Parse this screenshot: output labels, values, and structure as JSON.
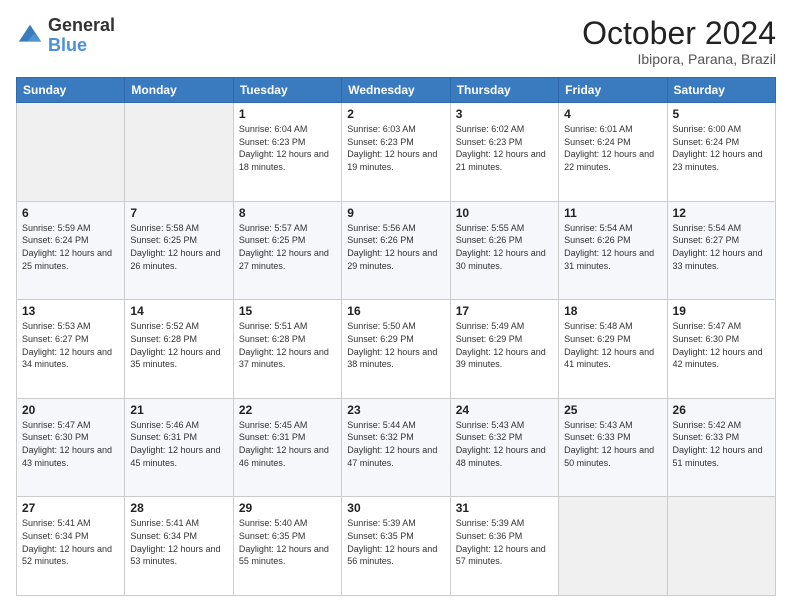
{
  "logo": {
    "general": "General",
    "blue": "Blue"
  },
  "title": {
    "month": "October 2024",
    "location": "Ibipora, Parana, Brazil"
  },
  "days_of_week": [
    "Sunday",
    "Monday",
    "Tuesday",
    "Wednesday",
    "Thursday",
    "Friday",
    "Saturday"
  ],
  "weeks": [
    [
      {
        "day": "",
        "info": ""
      },
      {
        "day": "",
        "info": ""
      },
      {
        "day": "1",
        "info": "Sunrise: 6:04 AM\nSunset: 6:23 PM\nDaylight: 12 hours and 18 minutes."
      },
      {
        "day": "2",
        "info": "Sunrise: 6:03 AM\nSunset: 6:23 PM\nDaylight: 12 hours and 19 minutes."
      },
      {
        "day": "3",
        "info": "Sunrise: 6:02 AM\nSunset: 6:23 PM\nDaylight: 12 hours and 21 minutes."
      },
      {
        "day": "4",
        "info": "Sunrise: 6:01 AM\nSunset: 6:24 PM\nDaylight: 12 hours and 22 minutes."
      },
      {
        "day": "5",
        "info": "Sunrise: 6:00 AM\nSunset: 6:24 PM\nDaylight: 12 hours and 23 minutes."
      }
    ],
    [
      {
        "day": "6",
        "info": "Sunrise: 5:59 AM\nSunset: 6:24 PM\nDaylight: 12 hours and 25 minutes."
      },
      {
        "day": "7",
        "info": "Sunrise: 5:58 AM\nSunset: 6:25 PM\nDaylight: 12 hours and 26 minutes."
      },
      {
        "day": "8",
        "info": "Sunrise: 5:57 AM\nSunset: 6:25 PM\nDaylight: 12 hours and 27 minutes."
      },
      {
        "day": "9",
        "info": "Sunrise: 5:56 AM\nSunset: 6:26 PM\nDaylight: 12 hours and 29 minutes."
      },
      {
        "day": "10",
        "info": "Sunrise: 5:55 AM\nSunset: 6:26 PM\nDaylight: 12 hours and 30 minutes."
      },
      {
        "day": "11",
        "info": "Sunrise: 5:54 AM\nSunset: 6:26 PM\nDaylight: 12 hours and 31 minutes."
      },
      {
        "day": "12",
        "info": "Sunrise: 5:54 AM\nSunset: 6:27 PM\nDaylight: 12 hours and 33 minutes."
      }
    ],
    [
      {
        "day": "13",
        "info": "Sunrise: 5:53 AM\nSunset: 6:27 PM\nDaylight: 12 hours and 34 minutes."
      },
      {
        "day": "14",
        "info": "Sunrise: 5:52 AM\nSunset: 6:28 PM\nDaylight: 12 hours and 35 minutes."
      },
      {
        "day": "15",
        "info": "Sunrise: 5:51 AM\nSunset: 6:28 PM\nDaylight: 12 hours and 37 minutes."
      },
      {
        "day": "16",
        "info": "Sunrise: 5:50 AM\nSunset: 6:29 PM\nDaylight: 12 hours and 38 minutes."
      },
      {
        "day": "17",
        "info": "Sunrise: 5:49 AM\nSunset: 6:29 PM\nDaylight: 12 hours and 39 minutes."
      },
      {
        "day": "18",
        "info": "Sunrise: 5:48 AM\nSunset: 6:29 PM\nDaylight: 12 hours and 41 minutes."
      },
      {
        "day": "19",
        "info": "Sunrise: 5:47 AM\nSunset: 6:30 PM\nDaylight: 12 hours and 42 minutes."
      }
    ],
    [
      {
        "day": "20",
        "info": "Sunrise: 5:47 AM\nSunset: 6:30 PM\nDaylight: 12 hours and 43 minutes."
      },
      {
        "day": "21",
        "info": "Sunrise: 5:46 AM\nSunset: 6:31 PM\nDaylight: 12 hours and 45 minutes."
      },
      {
        "day": "22",
        "info": "Sunrise: 5:45 AM\nSunset: 6:31 PM\nDaylight: 12 hours and 46 minutes."
      },
      {
        "day": "23",
        "info": "Sunrise: 5:44 AM\nSunset: 6:32 PM\nDaylight: 12 hours and 47 minutes."
      },
      {
        "day": "24",
        "info": "Sunrise: 5:43 AM\nSunset: 6:32 PM\nDaylight: 12 hours and 48 minutes."
      },
      {
        "day": "25",
        "info": "Sunrise: 5:43 AM\nSunset: 6:33 PM\nDaylight: 12 hours and 50 minutes."
      },
      {
        "day": "26",
        "info": "Sunrise: 5:42 AM\nSunset: 6:33 PM\nDaylight: 12 hours and 51 minutes."
      }
    ],
    [
      {
        "day": "27",
        "info": "Sunrise: 5:41 AM\nSunset: 6:34 PM\nDaylight: 12 hours and 52 minutes."
      },
      {
        "day": "28",
        "info": "Sunrise: 5:41 AM\nSunset: 6:34 PM\nDaylight: 12 hours and 53 minutes."
      },
      {
        "day": "29",
        "info": "Sunrise: 5:40 AM\nSunset: 6:35 PM\nDaylight: 12 hours and 55 minutes."
      },
      {
        "day": "30",
        "info": "Sunrise: 5:39 AM\nSunset: 6:35 PM\nDaylight: 12 hours and 56 minutes."
      },
      {
        "day": "31",
        "info": "Sunrise: 5:39 AM\nSunset: 6:36 PM\nDaylight: 12 hours and 57 minutes."
      },
      {
        "day": "",
        "info": ""
      },
      {
        "day": "",
        "info": ""
      }
    ]
  ]
}
